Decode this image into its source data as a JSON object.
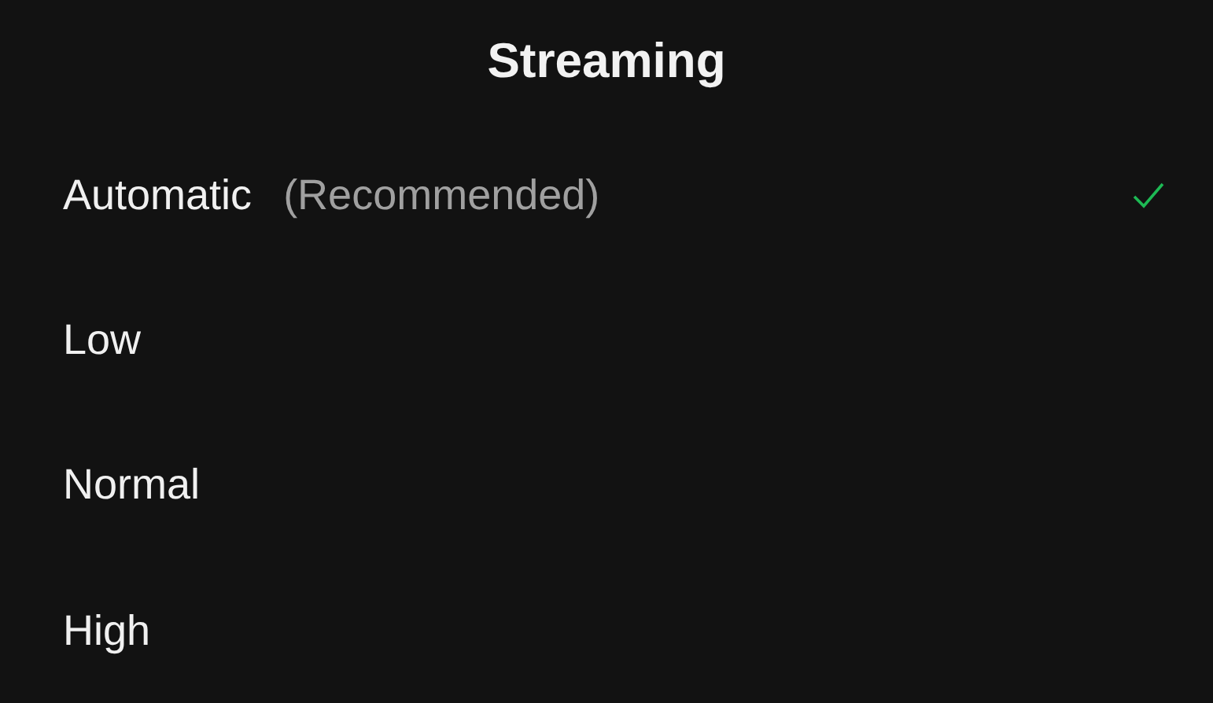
{
  "title": "Streaming",
  "options": [
    {
      "label": "Automatic",
      "note": "(Recommended)",
      "selected": true
    },
    {
      "label": "Low",
      "selected": false
    },
    {
      "label": "Normal",
      "selected": false
    },
    {
      "label": "High",
      "selected": false
    }
  ]
}
